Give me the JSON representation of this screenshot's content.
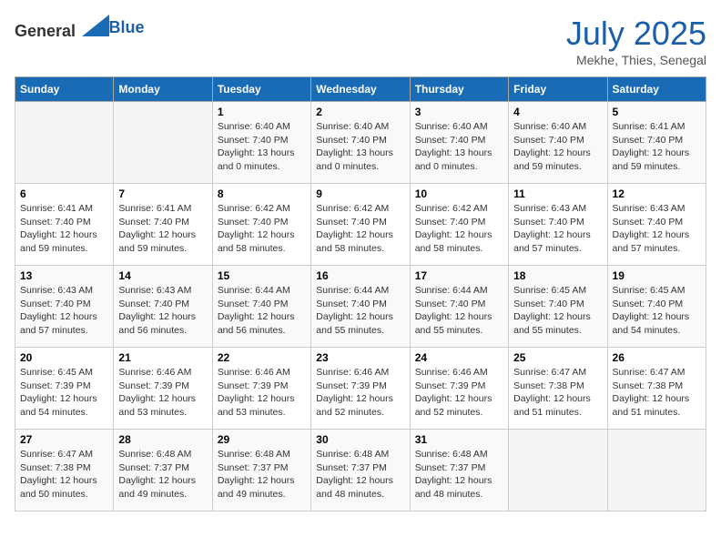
{
  "header": {
    "logo_general": "General",
    "logo_blue": "Blue",
    "month_year": "July 2025",
    "location": "Mekhe, Thies, Senegal"
  },
  "days_of_week": [
    "Sunday",
    "Monday",
    "Tuesday",
    "Wednesday",
    "Thursday",
    "Friday",
    "Saturday"
  ],
  "weeks": [
    [
      {
        "day": "",
        "sunrise": "",
        "sunset": "",
        "daylight": ""
      },
      {
        "day": "",
        "sunrise": "",
        "sunset": "",
        "daylight": ""
      },
      {
        "day": "1",
        "sunrise": "Sunrise: 6:40 AM",
        "sunset": "Sunset: 7:40 PM",
        "daylight": "Daylight: 13 hours and 0 minutes."
      },
      {
        "day": "2",
        "sunrise": "Sunrise: 6:40 AM",
        "sunset": "Sunset: 7:40 PM",
        "daylight": "Daylight: 13 hours and 0 minutes."
      },
      {
        "day": "3",
        "sunrise": "Sunrise: 6:40 AM",
        "sunset": "Sunset: 7:40 PM",
        "daylight": "Daylight: 13 hours and 0 minutes."
      },
      {
        "day": "4",
        "sunrise": "Sunrise: 6:40 AM",
        "sunset": "Sunset: 7:40 PM",
        "daylight": "Daylight: 12 hours and 59 minutes."
      },
      {
        "day": "5",
        "sunrise": "Sunrise: 6:41 AM",
        "sunset": "Sunset: 7:40 PM",
        "daylight": "Daylight: 12 hours and 59 minutes."
      }
    ],
    [
      {
        "day": "6",
        "sunrise": "Sunrise: 6:41 AM",
        "sunset": "Sunset: 7:40 PM",
        "daylight": "Daylight: 12 hours and 59 minutes."
      },
      {
        "day": "7",
        "sunrise": "Sunrise: 6:41 AM",
        "sunset": "Sunset: 7:40 PM",
        "daylight": "Daylight: 12 hours and 59 minutes."
      },
      {
        "day": "8",
        "sunrise": "Sunrise: 6:42 AM",
        "sunset": "Sunset: 7:40 PM",
        "daylight": "Daylight: 12 hours and 58 minutes."
      },
      {
        "day": "9",
        "sunrise": "Sunrise: 6:42 AM",
        "sunset": "Sunset: 7:40 PM",
        "daylight": "Daylight: 12 hours and 58 minutes."
      },
      {
        "day": "10",
        "sunrise": "Sunrise: 6:42 AM",
        "sunset": "Sunset: 7:40 PM",
        "daylight": "Daylight: 12 hours and 58 minutes."
      },
      {
        "day": "11",
        "sunrise": "Sunrise: 6:43 AM",
        "sunset": "Sunset: 7:40 PM",
        "daylight": "Daylight: 12 hours and 57 minutes."
      },
      {
        "day": "12",
        "sunrise": "Sunrise: 6:43 AM",
        "sunset": "Sunset: 7:40 PM",
        "daylight": "Daylight: 12 hours and 57 minutes."
      }
    ],
    [
      {
        "day": "13",
        "sunrise": "Sunrise: 6:43 AM",
        "sunset": "Sunset: 7:40 PM",
        "daylight": "Daylight: 12 hours and 57 minutes."
      },
      {
        "day": "14",
        "sunrise": "Sunrise: 6:43 AM",
        "sunset": "Sunset: 7:40 PM",
        "daylight": "Daylight: 12 hours and 56 minutes."
      },
      {
        "day": "15",
        "sunrise": "Sunrise: 6:44 AM",
        "sunset": "Sunset: 7:40 PM",
        "daylight": "Daylight: 12 hours and 56 minutes."
      },
      {
        "day": "16",
        "sunrise": "Sunrise: 6:44 AM",
        "sunset": "Sunset: 7:40 PM",
        "daylight": "Daylight: 12 hours and 55 minutes."
      },
      {
        "day": "17",
        "sunrise": "Sunrise: 6:44 AM",
        "sunset": "Sunset: 7:40 PM",
        "daylight": "Daylight: 12 hours and 55 minutes."
      },
      {
        "day": "18",
        "sunrise": "Sunrise: 6:45 AM",
        "sunset": "Sunset: 7:40 PM",
        "daylight": "Daylight: 12 hours and 55 minutes."
      },
      {
        "day": "19",
        "sunrise": "Sunrise: 6:45 AM",
        "sunset": "Sunset: 7:40 PM",
        "daylight": "Daylight: 12 hours and 54 minutes."
      }
    ],
    [
      {
        "day": "20",
        "sunrise": "Sunrise: 6:45 AM",
        "sunset": "Sunset: 7:39 PM",
        "daylight": "Daylight: 12 hours and 54 minutes."
      },
      {
        "day": "21",
        "sunrise": "Sunrise: 6:46 AM",
        "sunset": "Sunset: 7:39 PM",
        "daylight": "Daylight: 12 hours and 53 minutes."
      },
      {
        "day": "22",
        "sunrise": "Sunrise: 6:46 AM",
        "sunset": "Sunset: 7:39 PM",
        "daylight": "Daylight: 12 hours and 53 minutes."
      },
      {
        "day": "23",
        "sunrise": "Sunrise: 6:46 AM",
        "sunset": "Sunset: 7:39 PM",
        "daylight": "Daylight: 12 hours and 52 minutes."
      },
      {
        "day": "24",
        "sunrise": "Sunrise: 6:46 AM",
        "sunset": "Sunset: 7:39 PM",
        "daylight": "Daylight: 12 hours and 52 minutes."
      },
      {
        "day": "25",
        "sunrise": "Sunrise: 6:47 AM",
        "sunset": "Sunset: 7:38 PM",
        "daylight": "Daylight: 12 hours and 51 minutes."
      },
      {
        "day": "26",
        "sunrise": "Sunrise: 6:47 AM",
        "sunset": "Sunset: 7:38 PM",
        "daylight": "Daylight: 12 hours and 51 minutes."
      }
    ],
    [
      {
        "day": "27",
        "sunrise": "Sunrise: 6:47 AM",
        "sunset": "Sunset: 7:38 PM",
        "daylight": "Daylight: 12 hours and 50 minutes."
      },
      {
        "day": "28",
        "sunrise": "Sunrise: 6:48 AM",
        "sunset": "Sunset: 7:37 PM",
        "daylight": "Daylight: 12 hours and 49 minutes."
      },
      {
        "day": "29",
        "sunrise": "Sunrise: 6:48 AM",
        "sunset": "Sunset: 7:37 PM",
        "daylight": "Daylight: 12 hours and 49 minutes."
      },
      {
        "day": "30",
        "sunrise": "Sunrise: 6:48 AM",
        "sunset": "Sunset: 7:37 PM",
        "daylight": "Daylight: 12 hours and 48 minutes."
      },
      {
        "day": "31",
        "sunrise": "Sunrise: 6:48 AM",
        "sunset": "Sunset: 7:37 PM",
        "daylight": "Daylight: 12 hours and 48 minutes."
      },
      {
        "day": "",
        "sunrise": "",
        "sunset": "",
        "daylight": ""
      },
      {
        "day": "",
        "sunrise": "",
        "sunset": "",
        "daylight": ""
      }
    ]
  ]
}
